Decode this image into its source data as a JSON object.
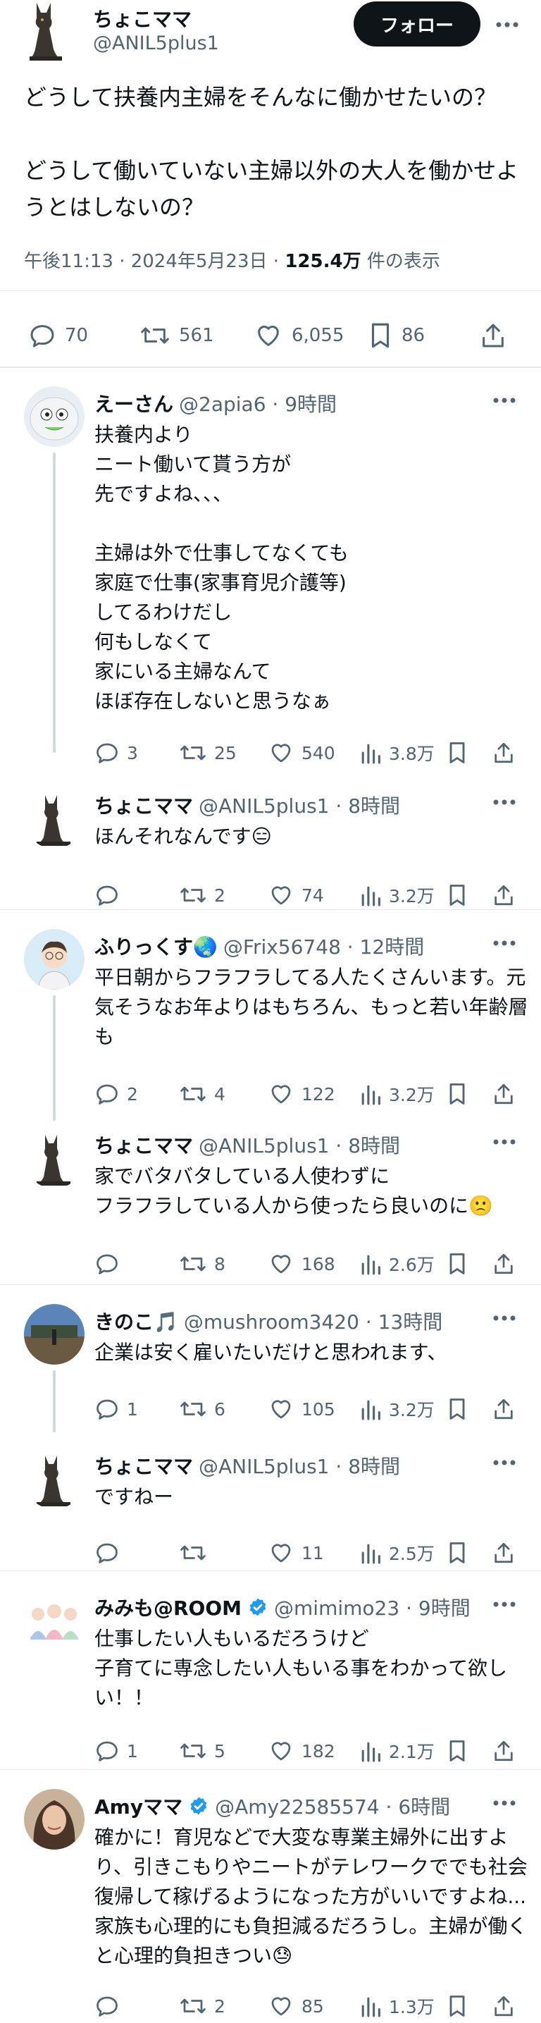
{
  "main": {
    "name": "ちょこママ",
    "handle": "@ANIL5plus1",
    "follow_label": "フォロー",
    "text": "どうして扶養内主婦をそんなに働かせたいの？\n\nどうして働いていない主婦以外の大人を働かせようとはしないの？",
    "meta_prefix": "午後11:13 · 2024年5月23日 · ",
    "views": "125.4万",
    "views_suffix": " 件の表示",
    "replies": "70",
    "retweets": "561",
    "likes": "6,055",
    "bookmarks": "86"
  },
  "replies": [
    {
      "name": "えーさん",
      "handle": "@2apia6 · 9時間",
      "text": "扶養内より\nニート働いて貰う方が\n先ですよね、、、\n\n主婦は外で仕事してなくても\n家庭で仕事(家事育児介護等)\nしてるわけだし\n何もしなくて\n家にいる主婦なんて\nほぼ存在しないと思うなぁ",
      "replies": "3",
      "retweets": "25",
      "likes": "540",
      "views": "3.8万"
    },
    {
      "name": "ちょこママ",
      "handle": "@ANIL5plus1 · 8時間",
      "text": "ほんそれなんです😑",
      "replies": "",
      "retweets": "2",
      "likes": "74",
      "views": "3.2万"
    },
    {
      "name": "ふりっくす🌏",
      "handle": "@Frix56748 · 12時間",
      "text": "平日朝からフラフラしてる人たくさんいます。元気そうなお年よりはもちろん、もっと若い年齢層も",
      "replies": "2",
      "retweets": "4",
      "likes": "122",
      "views": "3.2万"
    },
    {
      "name": "ちょこママ",
      "handle": "@ANIL5plus1 · 8時間",
      "text": "家でバタバタしている人使わずに\nフラフラしている人から使ったら良いのに🙁",
      "replies": "",
      "retweets": "8",
      "likes": "168",
      "views": "2.6万"
    },
    {
      "name": "きのこ🎵",
      "handle": "@mushroom3420 · 13時間",
      "text": "企業は安く雇いたいだけと思われます、",
      "replies": "1",
      "retweets": "6",
      "likes": "105",
      "views": "3.2万"
    },
    {
      "name": "ちょこママ",
      "handle": "@ANIL5plus1 · 8時間",
      "text": "ですねー",
      "replies": "",
      "retweets": "",
      "likes": "11",
      "views": "2.5万"
    },
    {
      "name": "みみも@ROOM",
      "handle": "@mimimo23 · 9時間",
      "text": "仕事したい人もいるだろうけど\n子育てに専念したい人もいる事をわかって欲しい！！",
      "replies": "1",
      "retweets": "5",
      "likes": "182",
      "views": "2.1万"
    },
    {
      "name": "Amyママ",
      "handle": "@Amy22585574 · 6時間",
      "text": "確かに！育児などで大変な専業主婦外に出すより、引きこもりやニートがテレワークででも社会復帰して稼げるようになった方がいいですよね...家族も心理的にも負担減るだろうし。主婦が働くと心理的負担きつい😓",
      "replies": "",
      "retweets": "2",
      "likes": "85",
      "views": "1.3万"
    }
  ],
  "icons": {
    "reply": "reply-icon",
    "retweet": "retweet-icon",
    "like": "heart-icon",
    "views": "views-icon",
    "bookmark": "bookmark-icon",
    "share": "share-icon",
    "more": "more-icon",
    "verified": "verified-badge-icon"
  },
  "colors": {
    "accent": "#1d9bf0",
    "text": "#0f1419",
    "muted": "#536471",
    "border": "#e6e9ec"
  }
}
